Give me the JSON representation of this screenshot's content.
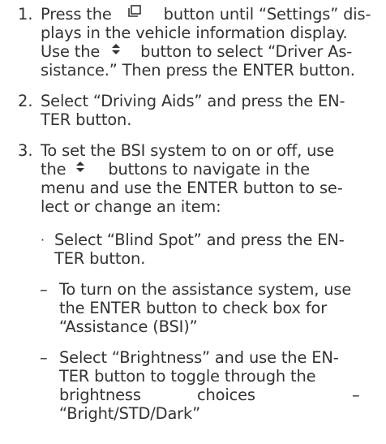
{
  "steps": [
    {
      "number": "1.",
      "lines": {
        "l1a": "Press the",
        "l1b": "button until “Settings” dis-",
        "l2": "plays in the vehicle information display.",
        "l3a": "Use the",
        "l3b": "button to select “Driver As-",
        "l4": "sistance.” Then press the ENTER button."
      },
      "icons": [
        "display-mode-button-icon",
        "up-down-arrow-icon"
      ]
    },
    {
      "number": "2.",
      "lines": {
        "l1": "Select “Driving Aids” and press the EN-",
        "l2": "TER button."
      }
    },
    {
      "number": "3.",
      "lines": {
        "l1": "To set the BSI system to on or off, use",
        "l2a": "the",
        "l2b": "buttons to navigate in the",
        "l3": "menu and use the ENTER button to se-",
        "l4": "lect or change an item:"
      },
      "icons": [
        "up-down-arrow-icon"
      ]
    }
  ],
  "substeps": [
    {
      "marker": "·",
      "lines": [
        "Select “Blind Spot” and press the EN-",
        "TER button."
      ]
    },
    {
      "marker": "–",
      "lines": [
        "To turn on the assistance system, use",
        "the ENTER button to check box for",
        "“Assistance (BSI)”"
      ]
    },
    {
      "marker": "–",
      "lines": [
        "Select “Brightness” and use the EN-",
        "TER button to toggle through the",
        "brightness",
        "choices",
        "–",
        "“Bright/STD/Dark”"
      ]
    }
  ],
  "colors": {
    "text": "#333333",
    "background": "#ffffff"
  }
}
